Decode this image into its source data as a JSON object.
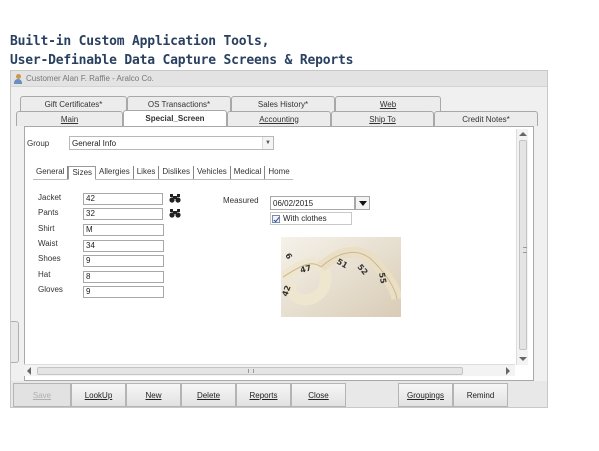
{
  "headline": {
    "line1": "Built-in Custom Application Tools,",
    "line2": "User-Definable Data Capture Screens & Reports"
  },
  "window": {
    "title": "Customer Alan F. Raffie - Aralco Co.",
    "title_icon": "person-icon"
  },
  "tabs_row1": [
    {
      "label": "Gift Certificates*"
    },
    {
      "label": "OS Transactions*"
    },
    {
      "label": "Sales History*"
    },
    {
      "label": "Web"
    }
  ],
  "tabs_row2": [
    {
      "label": "Main"
    },
    {
      "label": "Special_Screen"
    },
    {
      "label": "Accounting"
    },
    {
      "label": "Ship To"
    },
    {
      "label": "Credit Notes*"
    }
  ],
  "group": {
    "label": "Group",
    "value": "General Info"
  },
  "subtabs": [
    "General",
    "Sizes",
    "Allergies",
    "Likes",
    "Dislikes",
    "Vehicles",
    "Medical",
    "Home"
  ],
  "sizes": [
    {
      "label": "Jacket",
      "value": "42"
    },
    {
      "label": "Pants",
      "value": "32"
    },
    {
      "label": "Shirt",
      "value": "M"
    },
    {
      "label": "Waist",
      "value": "34"
    },
    {
      "label": "Shoes",
      "value": "9"
    },
    {
      "label": "Hat",
      "value": "8"
    },
    {
      "label": "Gloves",
      "value": "9"
    }
  ],
  "measured": {
    "label": "Measured",
    "date": "06/02/2015",
    "with_clothes_label": "With clothes",
    "with_clothes_checked": true
  },
  "image": {
    "description_icon": "measuring-tape-image"
  },
  "buttons": {
    "save": "Save",
    "lookup": "LookUp",
    "new": "New",
    "delete": "Delete",
    "reports": "Reports",
    "close": "Close",
    "groupings": "Groupings",
    "remind": "Remind"
  },
  "colors": {
    "headline": "#2a4060",
    "window_bg": "#f0f0f0",
    "panel_bg": "#ffffff"
  }
}
